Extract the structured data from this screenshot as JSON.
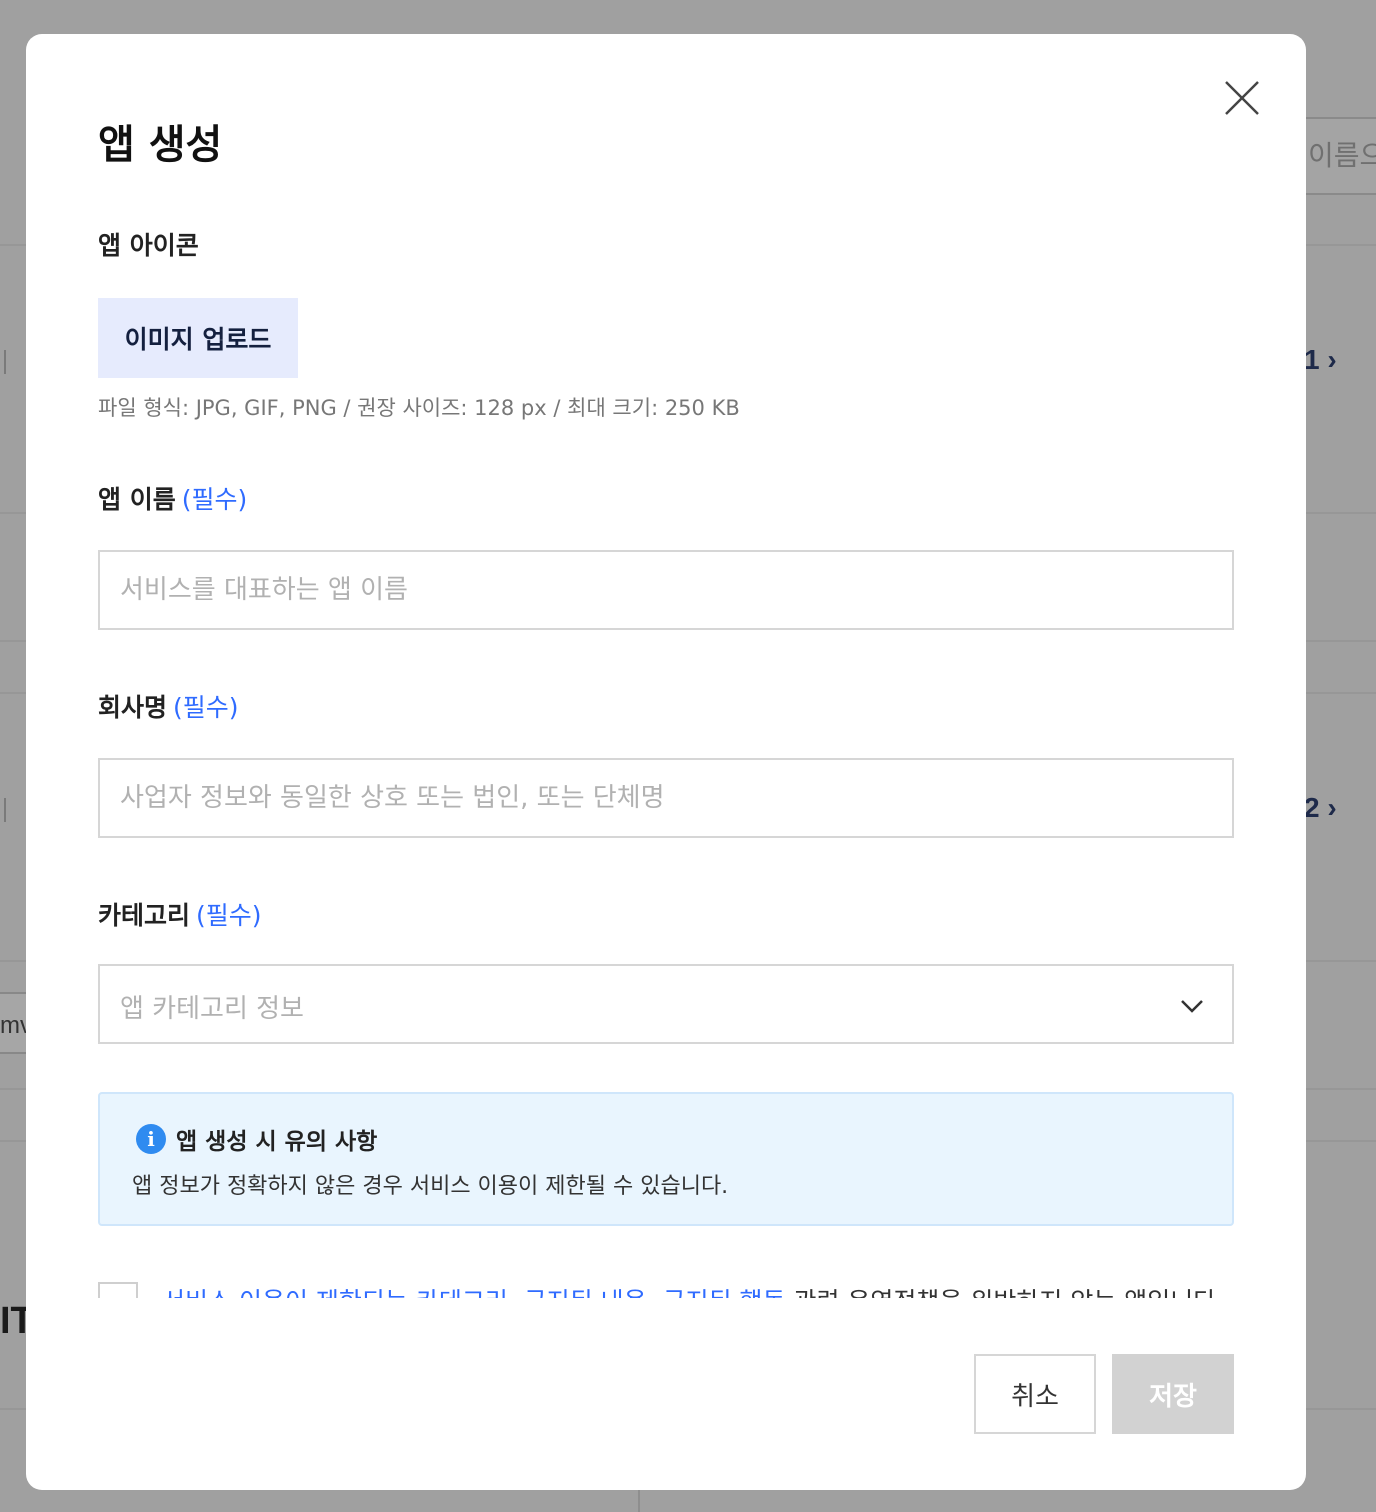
{
  "background": {
    "search_placeholder_fragment": "이름으로",
    "page_numbers": [
      "1 ›",
      "2 ›"
    ],
    "left_fragment": "mv",
    "left_heading_fragment": "IT"
  },
  "modal": {
    "title": "앱 생성",
    "icon_section": {
      "label": "앱 아이콘",
      "upload_button": "이미지 업로드",
      "help_text": "파일 형식: JPG, GIF, PNG / 권장 사이즈: 128 px / 최대 크기: 250 KB"
    },
    "app_name": {
      "label": "앱 이름",
      "required": "(필수)",
      "placeholder": "서비스를 대표하는 앱 이름",
      "value": ""
    },
    "company": {
      "label": "회사명",
      "required": "(필수)",
      "placeholder": "사업자 정보와 동일한 상호 또는 법인, 또는 단체명",
      "value": ""
    },
    "category": {
      "label": "카테고리",
      "required": "(필수)",
      "placeholder": "앱 카테고리 정보"
    },
    "notice": {
      "icon": "info-icon",
      "title": "앱 생성 시 유의 사항",
      "body": "앱 정보가 정확하지 않은 경우 서비스 이용이 제한될 수 있습니다."
    },
    "agreement": {
      "checked": false,
      "link_text": "서비스 이용이 제한되는 카테고리, 금지된 내용, 금지된 행동",
      "suffix_text": " 관련 운영정책을 위반하지 않는 앱입니다."
    },
    "buttons": {
      "cancel": "취소",
      "save": "저장"
    }
  },
  "colors": {
    "accent": "#2f6bff",
    "upload_bg": "#e6ebfd",
    "notice_bg": "#e9f5fe",
    "disabled_button": "#d2d2d2",
    "overlay": "#a0a0a0"
  }
}
